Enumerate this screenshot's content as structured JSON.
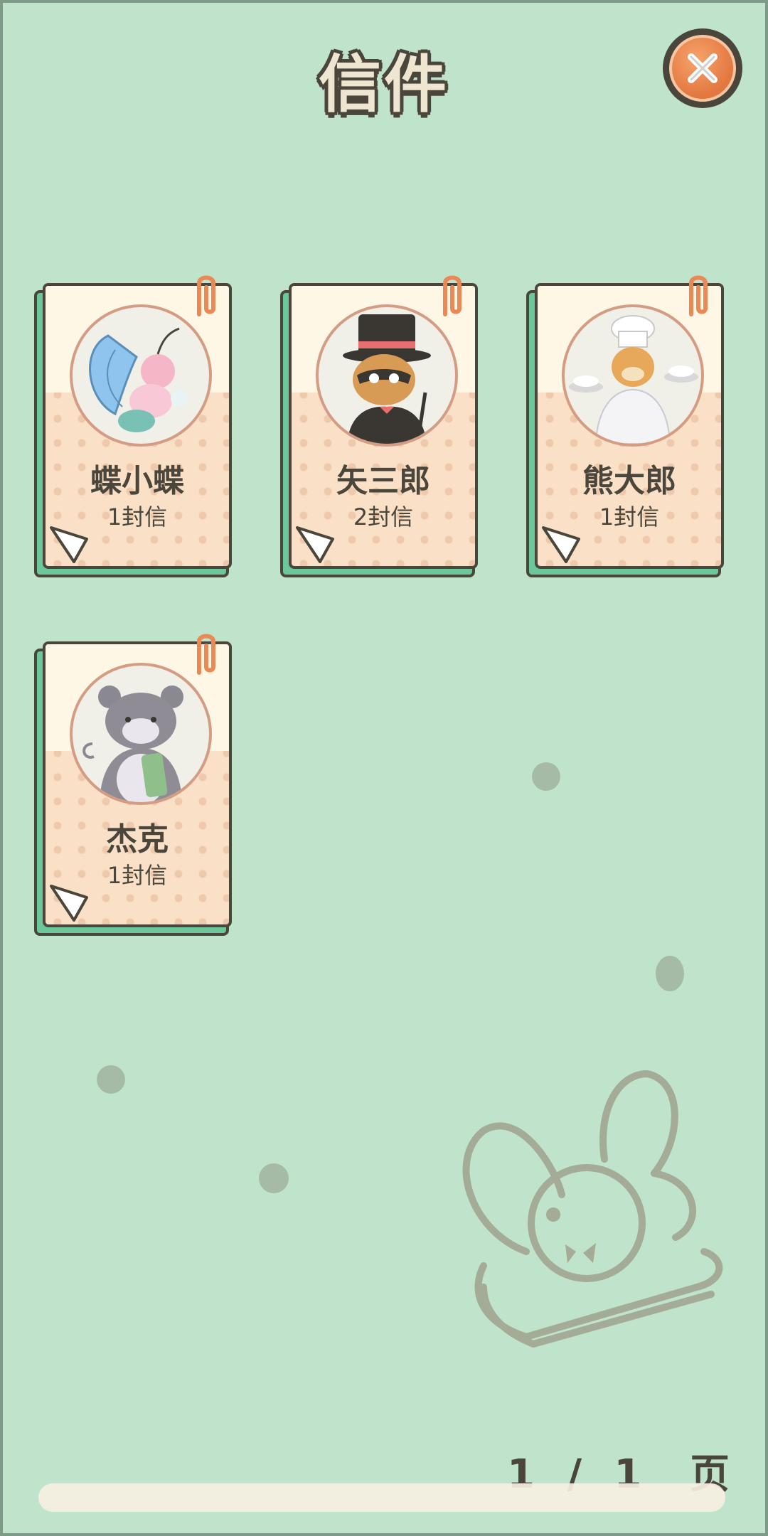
{
  "header": {
    "title": "信件"
  },
  "close": {
    "icon": "close-icon"
  },
  "letters": [
    {
      "name": "蝶小蝶",
      "count": "1封信",
      "avatar": "butterfly-character"
    },
    {
      "name": "矢三郎",
      "count": "2封信",
      "avatar": "raccoon-top-hat-character"
    },
    {
      "name": "熊大郎",
      "count": "1封信",
      "avatar": "bear-chef-character"
    },
    {
      "name": "杰克",
      "count": "1封信",
      "avatar": "hamster-character"
    }
  ],
  "pagination": {
    "current": "1",
    "separator": "/",
    "total": "1",
    "unit": "页"
  },
  "colors": {
    "background": "#bfe3cb",
    "outline": "#4b463c",
    "card_back": "#6cc79a",
    "accent": "#e2773f"
  }
}
